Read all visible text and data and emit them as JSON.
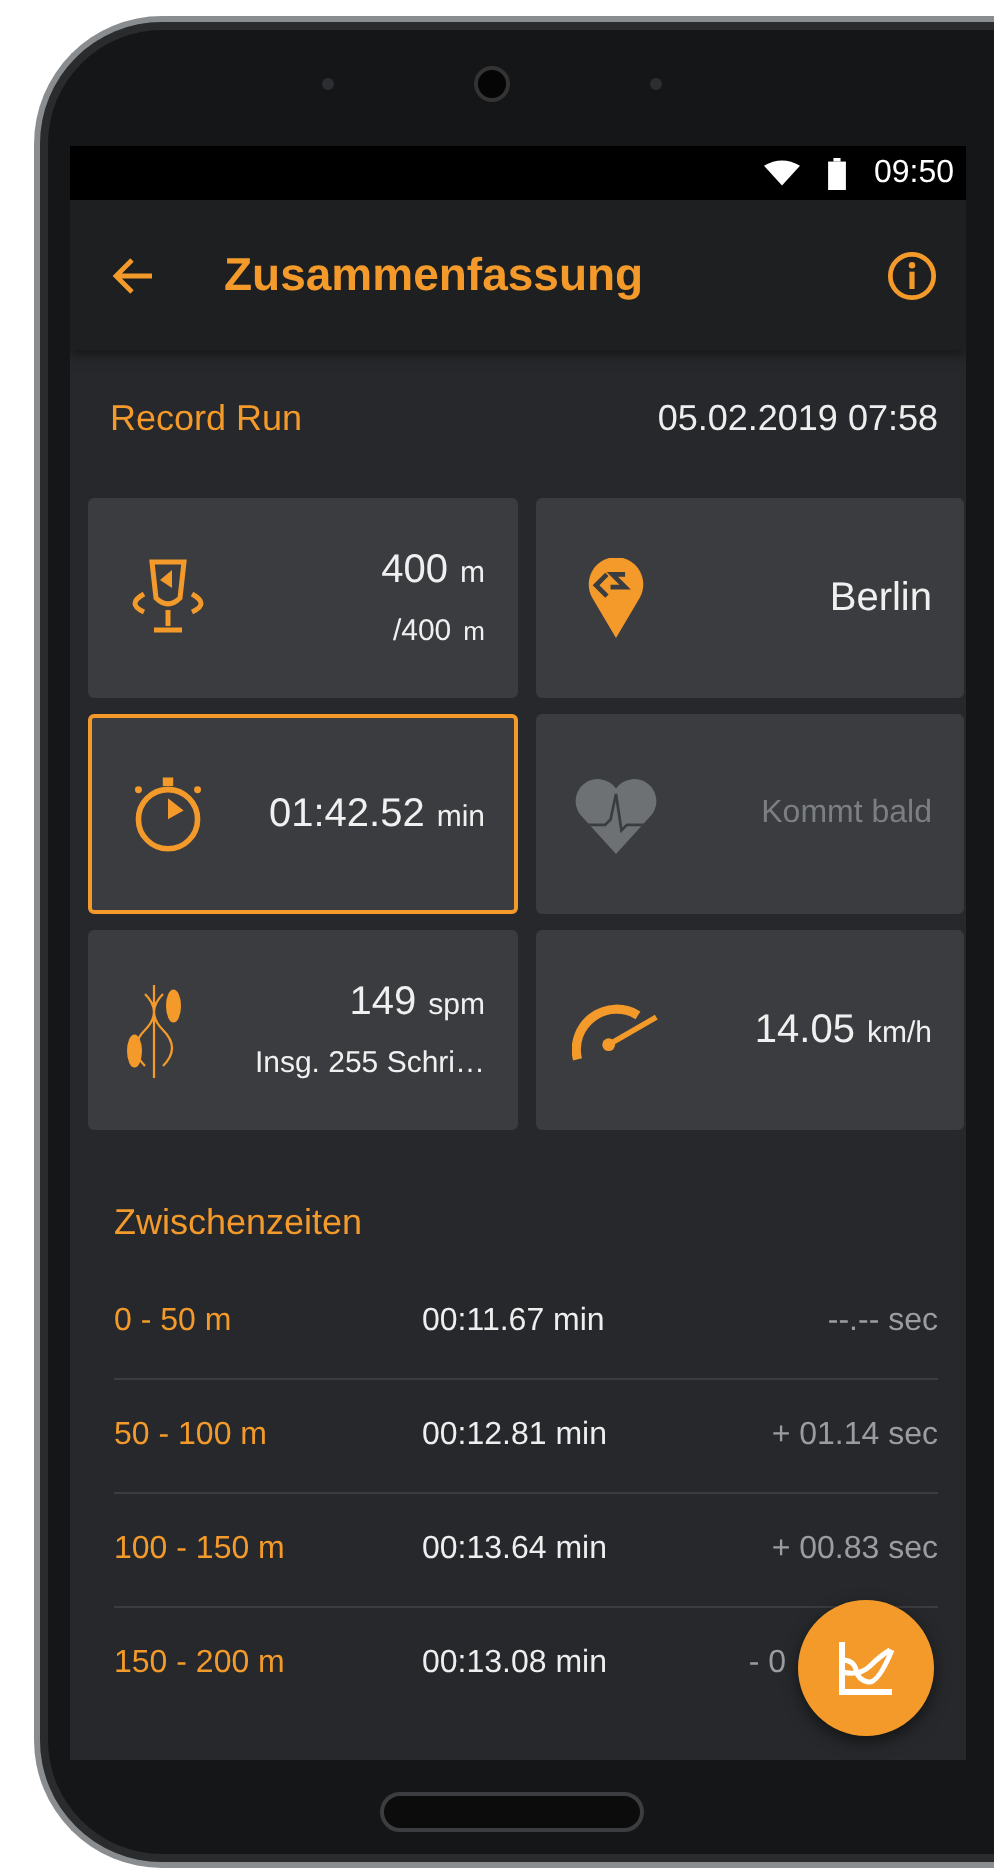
{
  "status_bar": {
    "time": "09:50"
  },
  "app_bar": {
    "title": "Zusammenfassung"
  },
  "header": {
    "label": "Record Run",
    "datetime": "05.02.2019 07:58"
  },
  "cards": [
    {
      "kind": "distance",
      "selected": false,
      "disabled": false,
      "value": "400",
      "unit": "m",
      "sub_value": "/400",
      "sub_unit": "m"
    },
    {
      "kind": "location",
      "selected": false,
      "disabled": false,
      "value": "Berlin"
    },
    {
      "kind": "time",
      "selected": true,
      "disabled": false,
      "value": "01:42.52",
      "unit": "min"
    },
    {
      "kind": "heart",
      "selected": false,
      "disabled": true,
      "value": "Kommt bald"
    },
    {
      "kind": "steps",
      "selected": false,
      "disabled": false,
      "value": "149",
      "unit": "spm",
      "sub_value": "Insg. 255 Schri…"
    },
    {
      "kind": "speed",
      "selected": false,
      "disabled": false,
      "value": "14.05",
      "unit": "km/h"
    }
  ],
  "splits": {
    "title": "Zwischenzeiten",
    "rows": [
      {
        "segment": "0 - 50 m",
        "time": "00:11.67 min",
        "delta": "--.-- sec"
      },
      {
        "segment": "50 - 100 m",
        "time": "00:12.81 min",
        "delta": "+ 01.14 sec"
      },
      {
        "segment": "100 - 150 m",
        "time": "00:13.64 min",
        "delta": "+ 00.83 sec"
      },
      {
        "segment": "150 - 200 m",
        "time": "00:13.08 min",
        "delta": "- 0"
      }
    ]
  }
}
